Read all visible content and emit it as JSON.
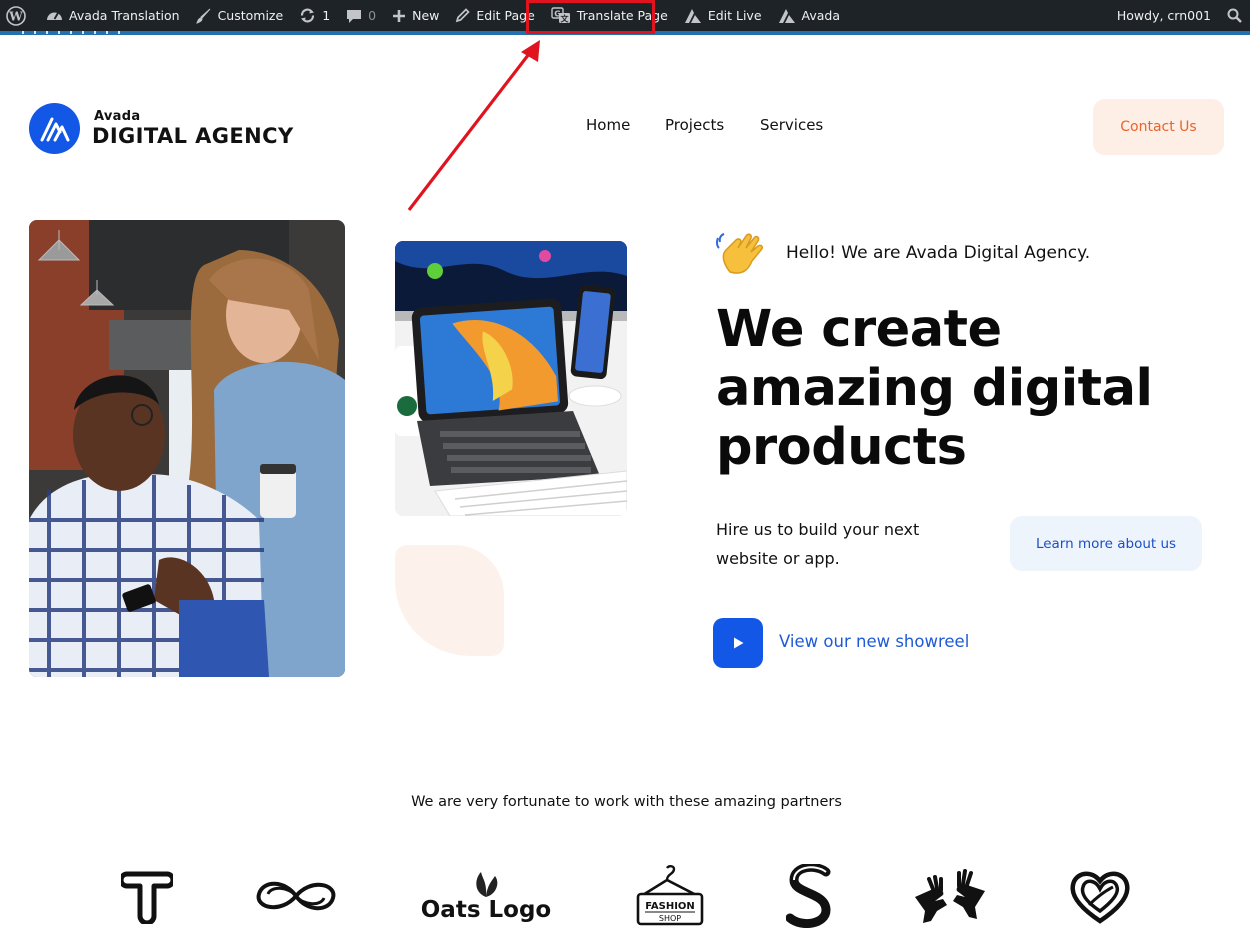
{
  "adminbar": {
    "site_name": "Avada Translation",
    "customize": "Customize",
    "updates_count": "1",
    "comments_count": "0",
    "new": "New",
    "edit_page": "Edit Page",
    "translate_page": "Translate Page",
    "edit_live": "Edit Live",
    "avada": "Avada",
    "howdy": "Howdy, crn001"
  },
  "header": {
    "logo_small": "Avada",
    "logo_big": "DIGITAL AGENCY",
    "nav": [
      "Home",
      "Projects",
      "Services"
    ],
    "contact": "Contact Us"
  },
  "hero": {
    "hello": "Hello! We are Avada Digital Agency.",
    "headline": "We create amazing digital products",
    "subtext": "Hire us to build your next website or app.",
    "learn_more": "Learn more about us",
    "showreel": "View our new showreel"
  },
  "partners": {
    "intro": "We are very fortunate to work with these amazing partners",
    "oats_logo": "Oats Logo",
    "fashion_top": "FASHION",
    "fashion_bottom": "SHOP"
  },
  "colors": {
    "brand_blue": "#1257e6",
    "accent_orange": "#e8642c",
    "adminbar_bg": "#1d2327",
    "highlight_red": "#e0141e"
  }
}
